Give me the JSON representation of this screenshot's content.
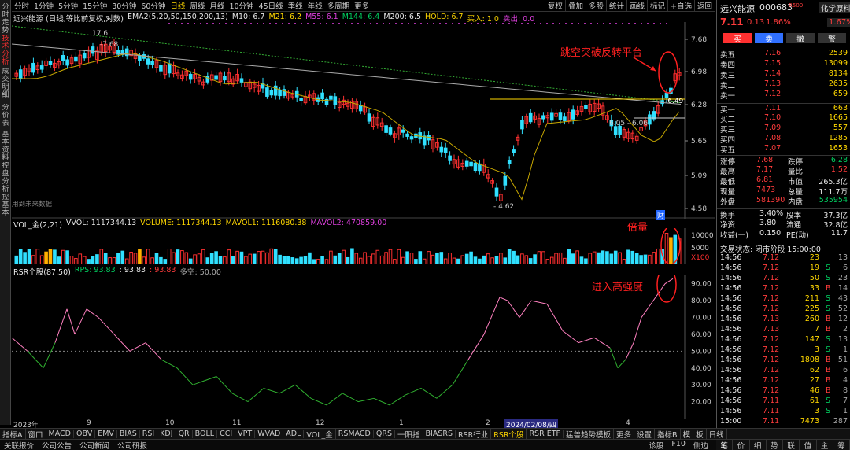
{
  "toolbar": {
    "periods": [
      "分时",
      "1分钟",
      "5分钟",
      "15分钟",
      "30分钟",
      "60分钟",
      "日线",
      "周线",
      "月线",
      "10分钟",
      "45日线",
      "季线",
      "年线",
      "多周期",
      "更多"
    ],
    "active_period": "日线",
    "right_buttons": [
      "复权",
      "叠加",
      "多股",
      "统计",
      "画线",
      "标记",
      "+自选",
      "返回"
    ]
  },
  "sidebar": [
    "分时走势",
    "技术分析",
    "成交明细",
    "分价表",
    "基本资料",
    "控盘分析",
    "控基本"
  ],
  "ma_legend": {
    "stock": "远兴能源 (日线,等比前复权,对数)",
    "ema": "EMA2(5,20,50,150,200,13)",
    "m10": "M10: 6.7",
    "m21": "M21: 6.2",
    "m55": "M55: 6.1",
    "m144": "M144: 6.4",
    "m200": "M200: 6.5",
    "hold": "HOLD: 6.7",
    "buy": "买入: 1.0",
    "sell": "卖出: 0.0"
  },
  "price_axis": [
    "7.68",
    "6.98",
    "6.28",
    "5.65",
    "5.09",
    "4.58"
  ],
  "price_labels": {
    "high": "17.6",
    "p768": "7.68",
    "low": "4.62",
    "p649": "6.49",
    "range": "6.05 - 6.06"
  },
  "no_future": "用到未来数据",
  "vol_legend": {
    "name": "VOL_金(2,21)",
    "vvol": "VVOL: 1117344.13",
    "volume": "VOLUME: 1117344.13",
    "mavol1": "MAVOL1: 1116080.38",
    "mavol2": "MAVOL2: 470859.00"
  },
  "vol_axis": [
    "10000",
    "5000",
    "X100"
  ],
  "rsr_legend": {
    "name": "RSR个股(87,50)",
    "rps": "RPS: 93.83",
    "v2": ": 93.83",
    "v3": ": 93.83",
    "duokong": "多空: 50.00"
  },
  "rsr_axis": [
    "90.00",
    "80.00",
    "70.00",
    "60.00",
    "50.00",
    "40.00",
    "30.00",
    "20.00"
  ],
  "x_axis": [
    "2023年",
    "9",
    "10",
    "11",
    "12",
    "1",
    "2",
    "2024/02/08/四",
    "4"
  ],
  "annotations": {
    "breakout": "跳空突破反转平台",
    "volume": "倍量",
    "strength": "进入高强度",
    "cai": "财"
  },
  "bottom_tabs": [
    "指标A",
    "窗口",
    "MACD",
    "OBV",
    "EMV",
    "BIAS",
    "RSI",
    "KDJ",
    "QR",
    "BOLL",
    "CCI",
    "VPT",
    "WVAD",
    "ADL",
    "VOL_金",
    "RSMACD",
    "QRS",
    "一阳指",
    "BIASRS",
    "RSR行业",
    "RSR个股",
    "RSR ETF",
    "猛兽趋势模板",
    "更多",
    "设置"
  ],
  "active_tab": "RSR个股",
  "bottom_right": [
    "指标B",
    "模",
    "板",
    "日线"
  ],
  "status_bar": [
    "关联报价",
    "公司公告",
    "公司新闻",
    "公司研报"
  ],
  "status_right": [
    "诊股",
    "F10",
    "侧边"
  ],
  "quote": {
    "name": "远兴能源",
    "code": "000683",
    "tag": "R500",
    "sector": "化学原料",
    "sector_pct": "1.67%",
    "price": "7.11",
    "chg": "0.13",
    "pct": "1.86%",
    "actions": [
      "买",
      "卖",
      "撤",
      "警"
    ],
    "asks": [
      [
        "卖五",
        "7.16",
        "2539"
      ],
      [
        "卖四",
        "7.15",
        "13099"
      ],
      [
        "卖三",
        "7.14",
        "8134"
      ],
      [
        "卖二",
        "7.13",
        "2635"
      ],
      [
        "卖一",
        "7.12",
        "659"
      ]
    ],
    "bids": [
      [
        "买一",
        "7.11",
        "663"
      ],
      [
        "买二",
        "7.10",
        "1665"
      ],
      [
        "买三",
        "7.09",
        "557"
      ],
      [
        "买四",
        "7.08",
        "1285"
      ],
      [
        "买五",
        "7.07",
        "1653"
      ]
    ],
    "stats": [
      [
        "涨停",
        "7.68",
        "跌停",
        "6.28"
      ],
      [
        "最高",
        "7.17",
        "量比",
        "1.52"
      ],
      [
        "最低",
        "6.81",
        "市值",
        "265.3亿"
      ],
      [
        "现量",
        "7473",
        "总量",
        "111.7万"
      ],
      [
        "外盘",
        "581390",
        "内盘",
        "535954"
      ]
    ],
    "fin": [
      [
        "换手",
        "3.40%",
        "股本",
        "37.3亿"
      ],
      [
        "净资",
        "3.80",
        "流通",
        "32.8亿"
      ],
      [
        "收益(一)",
        "0.150",
        "PE(动)",
        "11.7"
      ]
    ],
    "state": "交易状态: 闭市阶段 15:00:00",
    "ticks": [
      [
        "14:56",
        "7.12",
        "23",
        "",
        "13"
      ],
      [
        "14:56",
        "7.12",
        "19",
        "S",
        "6"
      ],
      [
        "14:56",
        "7.12",
        "50",
        "S",
        "23"
      ],
      [
        "14:56",
        "7.12",
        "33",
        "B",
        "14"
      ],
      [
        "14:56",
        "7.12",
        "211",
        "S",
        "43"
      ],
      [
        "14:56",
        "7.12",
        "225",
        "S",
        "52"
      ],
      [
        "14:56",
        "7.13",
        "260",
        "B",
        "12"
      ],
      [
        "14:56",
        "7.13",
        "7",
        "B",
        "2"
      ],
      [
        "14:56",
        "7.12",
        "147",
        "S",
        "13"
      ],
      [
        "14:56",
        "7.12",
        "3",
        "S",
        "1"
      ],
      [
        "14:56",
        "7.12",
        "1808",
        "B",
        "51"
      ],
      [
        "14:56",
        "7.12",
        "62",
        "B",
        "6"
      ],
      [
        "14:56",
        "7.12",
        "27",
        "B",
        "4"
      ],
      [
        "14:56",
        "7.12",
        "46",
        "B",
        "8"
      ],
      [
        "14:56",
        "7.11",
        "61",
        "S",
        "7"
      ],
      [
        "14:56",
        "7.11",
        "3",
        "S",
        "1"
      ],
      [
        "15:00",
        "7.11",
        "7473",
        "",
        "287"
      ]
    ],
    "panel_tabs": [
      "笔",
      "价",
      "细",
      "势",
      "联",
      "值",
      "主",
      "筹"
    ]
  }
}
